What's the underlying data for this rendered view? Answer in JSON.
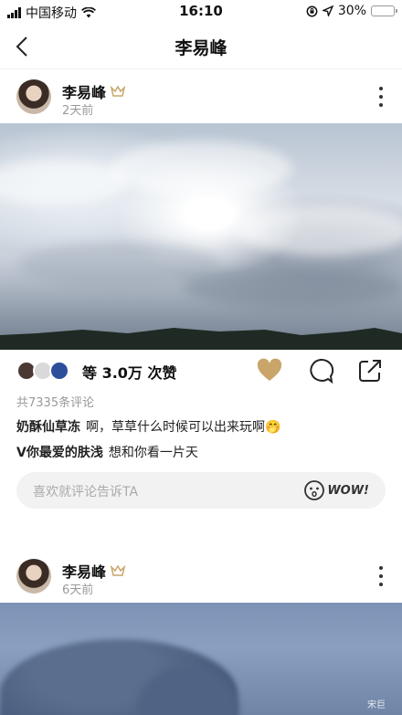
{
  "status_bar": {
    "carrier": "中国移动",
    "time": "16:10",
    "battery": "30%",
    "battery_level": 0.3
  },
  "nav": {
    "title": "李易峰"
  },
  "posts": [
    {
      "author": "李易峰",
      "time": "2天前",
      "likes": "等 3.0万 次赞",
      "comment_count": "共7335条评论",
      "comments": [
        {
          "user": "奶酥仙草冻",
          "text": "啊，草草什么时候可以出来玩啊🤭"
        },
        {
          "user": "V你最爱的肤浅",
          "text": "想和你看一片天"
        }
      ],
      "comment_placeholder": "喜欢就评论告诉TA",
      "wow_label": "WOW!"
    },
    {
      "author": "李易峰",
      "time": "6天前",
      "watermark": "宋巨"
    }
  ],
  "colors": {
    "like_gold": "#c9a56a",
    "vip_gold": "#c9a56a"
  }
}
